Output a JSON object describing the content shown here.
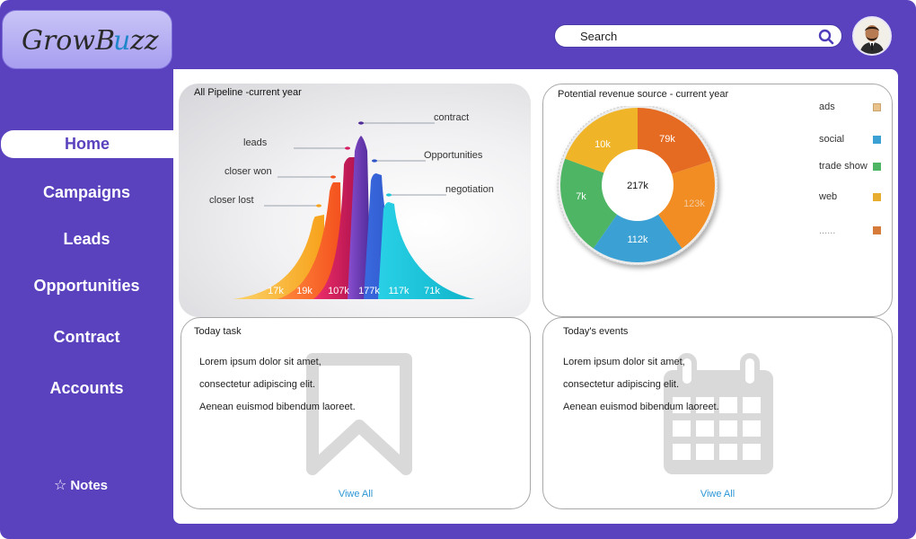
{
  "app": {
    "logo_text": "Grow Buzz"
  },
  "search": {
    "placeholder": "Search"
  },
  "sidebar": {
    "items": [
      {
        "label": "Home",
        "active": true
      },
      {
        "label": "Campaigns"
      },
      {
        "label": "Leads"
      },
      {
        "label": "Opportunities"
      },
      {
        "label": "Contract"
      },
      {
        "label": "Accounts"
      }
    ],
    "notes_label": "Notes"
  },
  "pipeline": {
    "title": "All Pipeline -current year",
    "stages": [
      {
        "label": "closer lost",
        "value": "17k",
        "color": "#f7a81b"
      },
      {
        "label": "closer won",
        "value": "19k",
        "color": "#f4511e"
      },
      {
        "label": "leads",
        "value": "107k",
        "color": "#d81b60"
      },
      {
        "label": "contract",
        "value": "177k",
        "color": "#6a3db3"
      },
      {
        "label": "Opportunities",
        "value": "117k",
        "color": "#2f55c7"
      },
      {
        "label": "negotiation",
        "value": "71k",
        "color": "#1cc5d8"
      }
    ]
  },
  "revenue": {
    "title": "Potential revenue source - current year",
    "total": "217k",
    "slices": [
      {
        "value": "79k",
        "color": "#e66b22"
      },
      {
        "value": "123k",
        "color": "#f18d22"
      },
      {
        "value": "112k",
        "color": "#3ba0d3"
      },
      {
        "value": "7k",
        "color": "#4db564"
      },
      {
        "value": "10k",
        "color": "#f0b429"
      }
    ],
    "legend": [
      {
        "label": "ads",
        "color": "#e8c28a"
      },
      {
        "label": "social",
        "color": "#3ba0d3"
      },
      {
        "label": "trade show",
        "color": "#4db564"
      },
      {
        "label": "web",
        "color": "#e6ad2e"
      },
      {
        "label": "......",
        "color": "#d77b3a"
      }
    ]
  },
  "task": {
    "title": "Today task",
    "lines": [
      "Lorem ipsum dolor sit amet,",
      "consectetur adipiscing elit.",
      "Aenean euismod bibendum laoreet."
    ],
    "view_all": "Viwe All"
  },
  "events": {
    "title": "Today's events",
    "lines": [
      "Lorem ipsum dolor sit amet,",
      "consectetur adipiscing elit.",
      "Aenean euismod bibendum laoreet."
    ],
    "view_all": "Viwe All"
  }
}
